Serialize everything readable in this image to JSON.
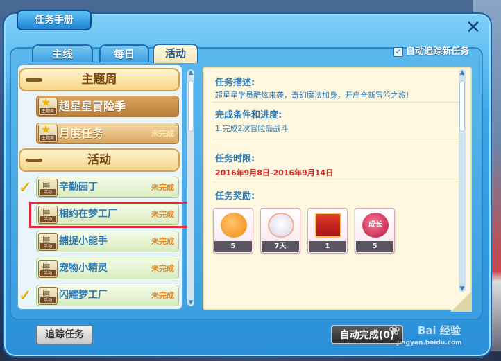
{
  "window": {
    "title": "任务手册",
    "close_symbol": "✕"
  },
  "tabs": [
    {
      "label": "主线",
      "active": false
    },
    {
      "label": "每日",
      "active": false
    },
    {
      "label": "活动",
      "active": true
    }
  ],
  "auto_track": {
    "label": "自动追踪新任务",
    "checked": true
  },
  "task_list": {
    "groups": [
      {
        "header": "主题周",
        "items": [
          {
            "icon": "star-icon",
            "icon_tag": "主题周",
            "name": "超星星冒险季",
            "status": "",
            "checked": false
          },
          {
            "icon": "star-icon",
            "icon_tag": "主题周",
            "name": "月度任务",
            "status": "未完成",
            "checked": false
          }
        ]
      },
      {
        "header": "活动",
        "items": [
          {
            "icon": "book-icon",
            "icon_tag": "活动",
            "name": "辛勤园丁",
            "status": "未完成",
            "checked": true
          },
          {
            "icon": "book-icon",
            "icon_tag": "活动",
            "name": "相约在梦工厂",
            "status": "未完成",
            "checked": false
          },
          {
            "icon": "book-icon",
            "icon_tag": "活动",
            "name": "捕捉小能手",
            "status": "未完成",
            "checked": false
          },
          {
            "icon": "book-icon",
            "icon_tag": "活动",
            "name": "宠物小精灵",
            "status": "未完成",
            "checked": false
          },
          {
            "icon": "book-icon",
            "icon_tag": "活动",
            "name": "闪耀梦工厂",
            "status": "未完成",
            "checked": true
          }
        ]
      }
    ]
  },
  "details": {
    "description_title": "任务描述:",
    "description_text": "超星星学员酷炫来袭，奇幻魔法加身，开启全新冒险之旅!",
    "conditions_title": "完成条件和进度:",
    "conditions_text": "1.完成2次冒险岛战斗",
    "time_limit_title": "任务时限:",
    "time_limit_text": "2016年9月8日-2016年9月14日",
    "rewards_title": "任务奖励:",
    "rewards": [
      {
        "icon": "orange-fruit-icon",
        "count": "5"
      },
      {
        "icon": "white-creature-icon",
        "count": "7天"
      },
      {
        "icon": "red-envelope-icon",
        "count": "1"
      },
      {
        "icon": "growth-apple-icon",
        "count": "5",
        "art_label": "成长"
      }
    ]
  },
  "buttons": {
    "track": "追踪任务",
    "auto_complete": "自动完成(0)"
  },
  "watermark": {
    "brand": "Bai 经验",
    "url": "jingyan.baidu.com"
  },
  "colors": {
    "frame_blue": "#2a8fd8",
    "highlight_red": "#e8283a",
    "status_orange": "#e08a2a",
    "date_red": "#d62a2a",
    "text_blue": "#2d7ab8"
  }
}
